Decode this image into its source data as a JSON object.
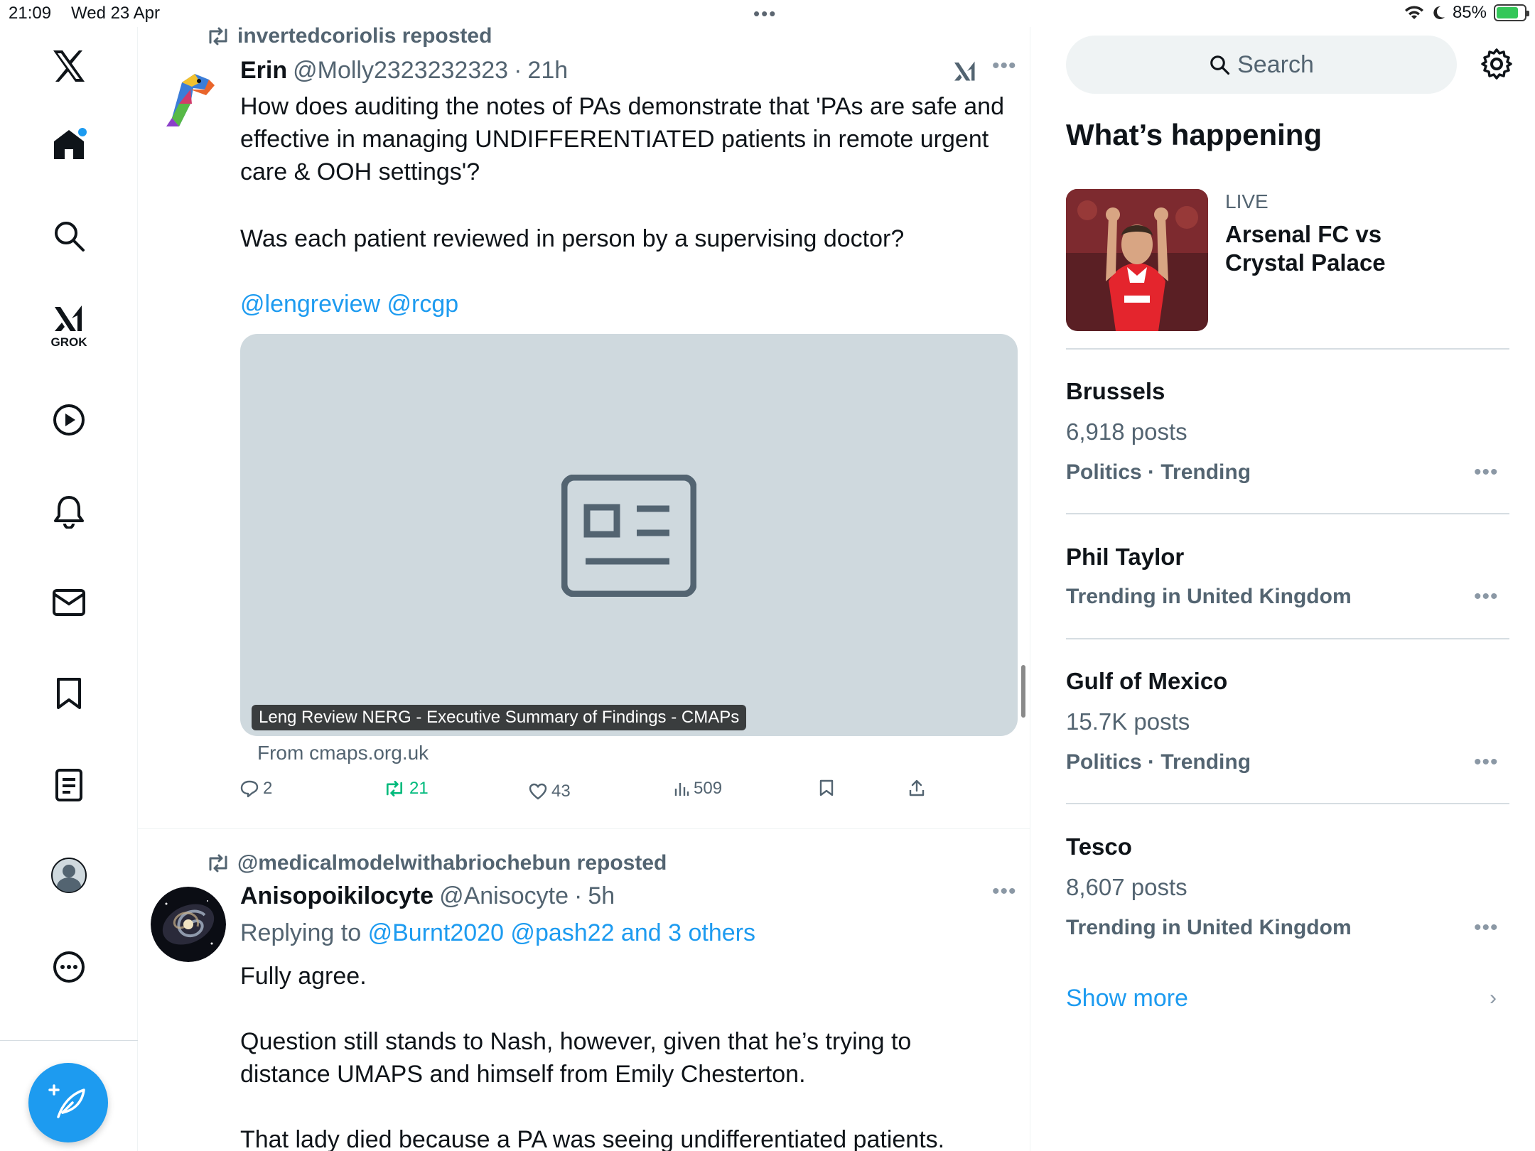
{
  "status_bar": {
    "time": "21:09",
    "date": "Wed 23 Apr",
    "battery": "85%"
  },
  "nav": {
    "grok_label": "GROK"
  },
  "feed": {
    "tweet1": {
      "repost_label": "invertedcoriolis reposted",
      "author_name": "Erin",
      "handle": "@Molly2323232323",
      "time": "21h",
      "text_lines": [
        "How does auditing the notes of PAs demonstrate that 'PAs are safe and",
        "effective in managing UNDIFFERENTIATED patients in remote urgent",
        "care & OOH settings'?"
      ],
      "question": "Was each patient reviewed in person by a supervising doctor?",
      "mentions": "@lengreview @rcgp",
      "card_caption": "Leng Review NERG - Executive Summary of Findings - CMAPs",
      "card_source": "From cmaps.org.uk",
      "replies": "2",
      "reposts": "21",
      "likes": "43",
      "views": "509"
    },
    "tweet2": {
      "repost_label": "@medicalmodelwithabriochebun reposted",
      "author_name": "Anisopoikilocyte",
      "handle": "@Anisocyte",
      "time": "5h",
      "replying_prefix": "Replying to",
      "replying_to": "@Burnt2020 @pash22 and 3 others",
      "line1": "Fully agree.",
      "line2a": "Question still stands to Nash, however, given that he’s trying to",
      "line2b": "distance UMAPS and himself from Emily Chesterton.",
      "line3": "That lady died because a PA was seeing undifferentiated patients."
    }
  },
  "sidebar": {
    "search_placeholder": "Search",
    "title": "What’s happening",
    "live": {
      "badge": "LIVE",
      "title_line1": "Arsenal FC vs",
      "title_line2": "Crystal Palace"
    },
    "trends": [
      {
        "name": "Brussels",
        "posts": "6,918 posts",
        "category": "Politics · Trending"
      },
      {
        "name": "Phil Taylor",
        "category": "Trending in United Kingdom"
      },
      {
        "name": "Gulf of Mexico",
        "posts": "15.7K posts",
        "category": "Politics · Trending"
      },
      {
        "name": "Tesco",
        "posts": "8,607 posts",
        "category": "Trending in United Kingdom"
      }
    ],
    "show_more": "Show more"
  }
}
